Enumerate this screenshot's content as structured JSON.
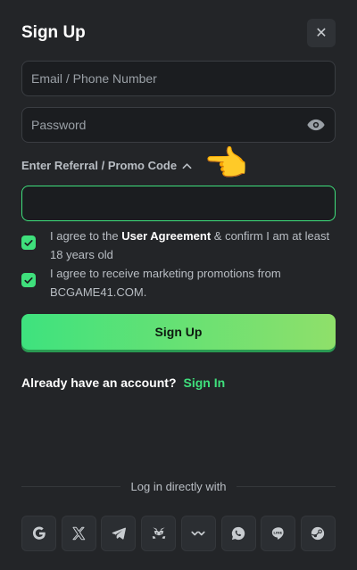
{
  "modal": {
    "title": "Sign Up",
    "close_glyph": "✕"
  },
  "form": {
    "email_placeholder": "Email / Phone Number",
    "password_placeholder": "Password",
    "referral_label": "Enter Referral / Promo Code",
    "promo_value": "",
    "hand_emoji": "👈"
  },
  "agreements": [
    {
      "checked": true,
      "prefix": "I agree to the ",
      "link": "User Agreement",
      "suffix": " & confirm I am at least 18 years old"
    },
    {
      "checked": true,
      "text": "I agree to receive marketing promotions from BCGAME41.COM."
    }
  ],
  "signup_button": "Sign Up",
  "footer": {
    "have_account": "Already have an account?",
    "sign_in": "Sign In",
    "login_with": "Log in directly with"
  },
  "social": [
    "google-icon",
    "x-icon",
    "telegram-icon",
    "metamask-icon",
    "walletconnect-icon",
    "whatsapp-icon",
    "line-icon",
    "steam-icon"
  ],
  "colors": {
    "accent": "#3fe07c",
    "background": "#232528"
  }
}
